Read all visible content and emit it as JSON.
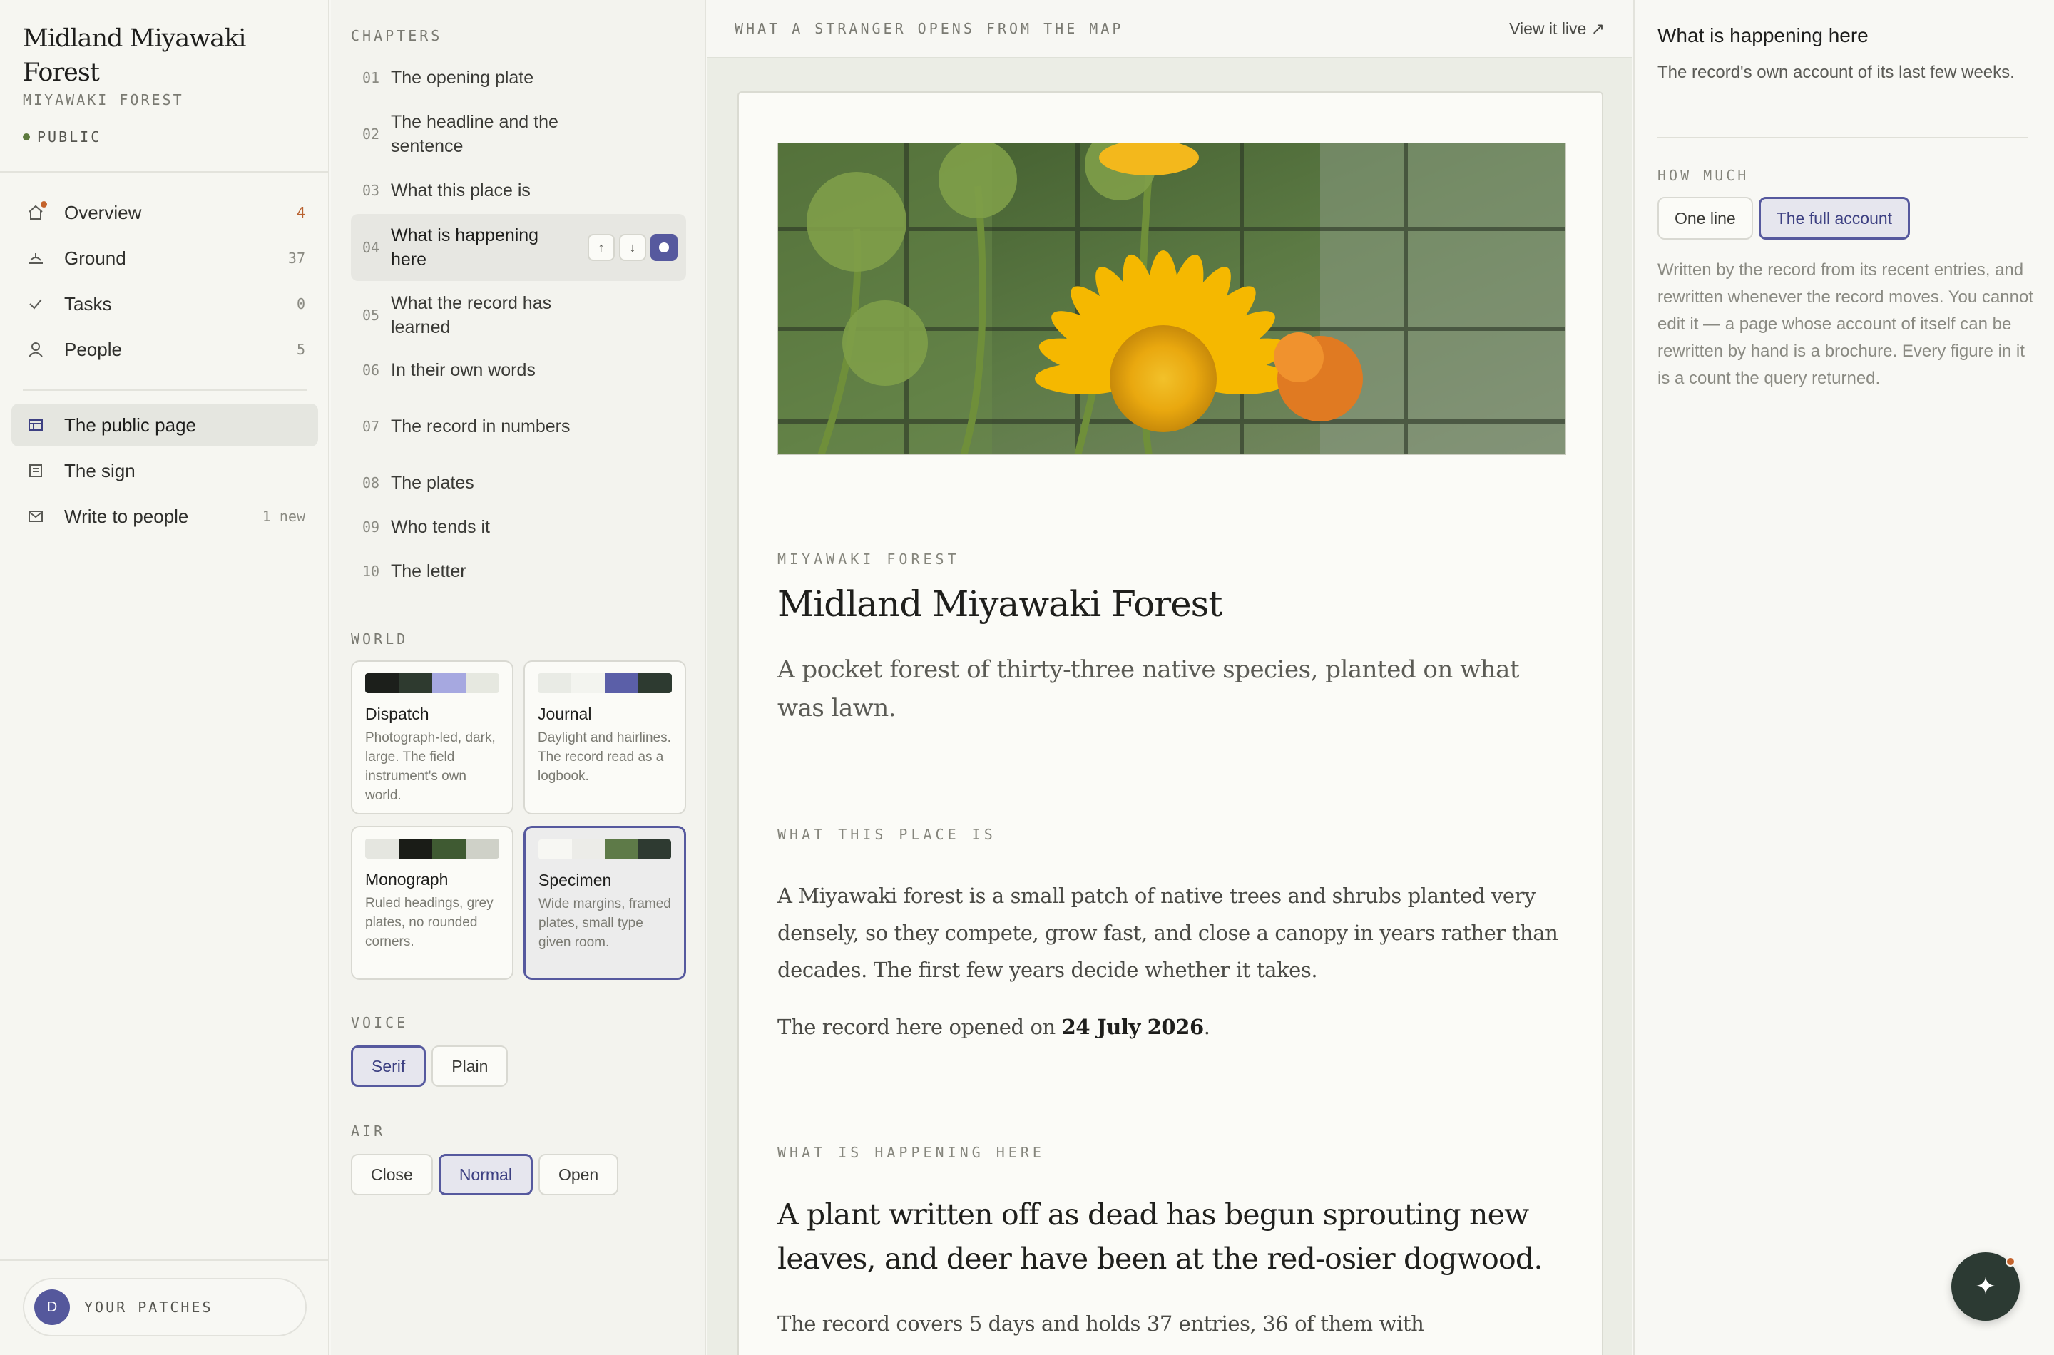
{
  "site": {
    "title": "Midland Miyawaki Forest",
    "kind": "MIYAWAKI FOREST",
    "visibility": "PUBLIC"
  },
  "nav": {
    "items": [
      {
        "label": "Overview",
        "count": "4",
        "icon": "home-icon"
      },
      {
        "label": "Ground",
        "count": "37",
        "icon": "ground-icon"
      },
      {
        "label": "Tasks",
        "count": "0",
        "icon": "check-icon"
      },
      {
        "label": "People",
        "count": "5",
        "icon": "person-icon"
      }
    ],
    "secondary": [
      {
        "label": "The public page",
        "count": "",
        "icon": "layout-icon"
      },
      {
        "label": "The sign",
        "count": "",
        "icon": "sign-icon"
      },
      {
        "label": "Write to people",
        "count": "1 new",
        "icon": "mail-icon"
      }
    ],
    "patches": {
      "avatar": "D",
      "label": "YOUR PATCHES"
    }
  },
  "chapters": {
    "heading": "CHAPTERS",
    "items": [
      {
        "num": "01",
        "label": "The opening plate"
      },
      {
        "num": "02",
        "label": "The headline and the sentence"
      },
      {
        "num": "03",
        "label": "What this place is"
      },
      {
        "num": "04",
        "label": "What is happening here"
      },
      {
        "num": "05",
        "label": "What the record has learned"
      },
      {
        "num": "06",
        "label": "In their own words"
      },
      {
        "num": "07",
        "label": "The record in numbers"
      },
      {
        "num": "08",
        "label": "The plates"
      },
      {
        "num": "09",
        "label": "Who tends it"
      },
      {
        "num": "10",
        "label": "The letter"
      }
    ]
  },
  "world": {
    "heading": "WORLD",
    "options": [
      {
        "name": "Dispatch",
        "desc": "Photograph-led, dark, large. The field instrument's own world.",
        "colors": [
          "#1c1f1b",
          "#2e3a2f",
          "#a6a8e0",
          "#e6e8e0"
        ]
      },
      {
        "name": "Journal",
        "desc": "Daylight and hairlines. The record read as a logbook.",
        "colors": [
          "#e9ebe5",
          "#f3f4ef",
          "#5b5fa8",
          "#2d3a30"
        ]
      },
      {
        "name": "Monograph",
        "desc": "Ruled headings, grey plates, no rounded corners.",
        "colors": [
          "#e5e6e0",
          "#1a1c17",
          "#3f5a32",
          "#cfd1c8"
        ]
      },
      {
        "name": "Specimen",
        "desc": "Wide margins, framed plates, small type given room.",
        "colors": [
          "#f7f7f3",
          "#ecece8",
          "#5e7a48",
          "#2e3a31"
        ]
      }
    ]
  },
  "voice": {
    "heading": "VOICE",
    "options": [
      "Serif",
      "Plain"
    ]
  },
  "air": {
    "heading": "AIR",
    "options": [
      "Close",
      "Normal",
      "Open"
    ]
  },
  "preview": {
    "caption": "WHAT A STRANGER OPENS FROM THE MAP",
    "view_live": "View it live ↗",
    "eyebrow": "MIYAWAKI FOREST",
    "title": "Midland Miyawaki Forest",
    "lede": "A pocket forest of thirty-three native species, planted on what was lawn.",
    "what_heading": "WHAT THIS PLACE IS",
    "what_body": "A Miyawaki forest is a small patch of native trees and shrubs planted very densely, so they compete, grow fast, and close a canopy in years rather than decades. The first few years decide whether it takes.",
    "opened_prefix": "The record here opened on ",
    "opened_date": "24 July 2026",
    "opened_suffix": ".",
    "happening_heading": "WHAT IS HAPPENING HERE",
    "happening_headline": "A plant written off as dead has begun sprouting new leaves, and deer have been at the red-osier dogwood.",
    "happening_body": "The record covers 5 days and holds 37 entries, 36 of them with"
  },
  "inspector": {
    "title": "What is happening here",
    "subtitle": "The record's own account of its last few weeks.",
    "caption": "HOW MUCH",
    "options": [
      "One line",
      "The full account"
    ],
    "note": "Written by the record from its recent entries, and rewritten whenever the record moves. You cannot edit it — a page whose account of itself can be rewritten by hand is a brochure. Every figure in it is a count the query returned."
  },
  "fab": {
    "icon": "sparkle-icon"
  }
}
